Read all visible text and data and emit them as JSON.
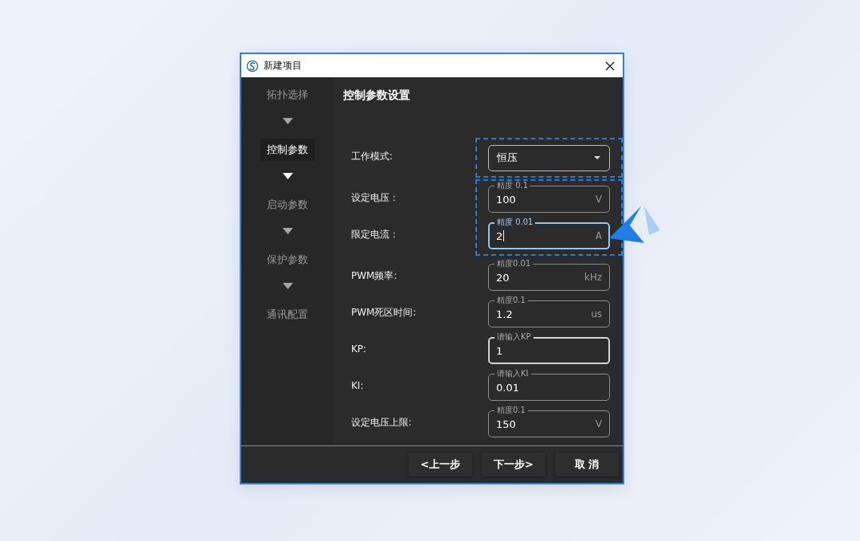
{
  "window": {
    "title": "新建项目"
  },
  "steps": [
    {
      "label": "拓扑选择",
      "selected": false
    },
    {
      "label": "控制参数",
      "selected": true
    },
    {
      "label": "启动参数",
      "selected": false
    },
    {
      "label": "保护参数",
      "selected": false
    },
    {
      "label": "通讯配置",
      "selected": false
    }
  ],
  "section_title": "控制参数设置",
  "field_groups": [
    {
      "highlighted": true,
      "fields": [
        {
          "kind": "select",
          "label": "工作模式:",
          "value": "恒压",
          "focused": false,
          "hovered": false
        }
      ]
    },
    {
      "highlighted": true,
      "fields": [
        {
          "kind": "number",
          "label": "设定电压：",
          "legend": "精度 0.1",
          "value": "100",
          "unit": "V",
          "focused": false,
          "hovered": false
        },
        {
          "kind": "number",
          "label": "限定电流：",
          "legend": "精度 0.01",
          "value": "2",
          "unit": "A",
          "focused": true,
          "hovered": false
        }
      ]
    },
    {
      "highlighted": false,
      "fields": [
        {
          "kind": "number",
          "label": "PWM频率:",
          "legend": "精度0.01",
          "value": "20",
          "unit": "kHz",
          "focused": false,
          "hovered": false
        },
        {
          "kind": "number",
          "label": "PWM死区时间:",
          "legend": "精度0.1",
          "value": "1.2",
          "unit": "us",
          "focused": false,
          "hovered": false
        },
        {
          "kind": "number",
          "label": "KP:",
          "legend": "请输入KP",
          "value": "1",
          "focused": false,
          "hovered": true
        },
        {
          "kind": "number",
          "label": "KI:",
          "legend": "请输入KI",
          "value": "0.01",
          "focused": false,
          "hovered": false
        },
        {
          "kind": "number",
          "label": "设定电压上限:",
          "legend": "精度0.1",
          "value": "150",
          "unit": "V",
          "focused": false,
          "hovered": false
        }
      ]
    }
  ],
  "buttons": [
    "<上一步",
    "下一步>",
    "取 消"
  ]
}
